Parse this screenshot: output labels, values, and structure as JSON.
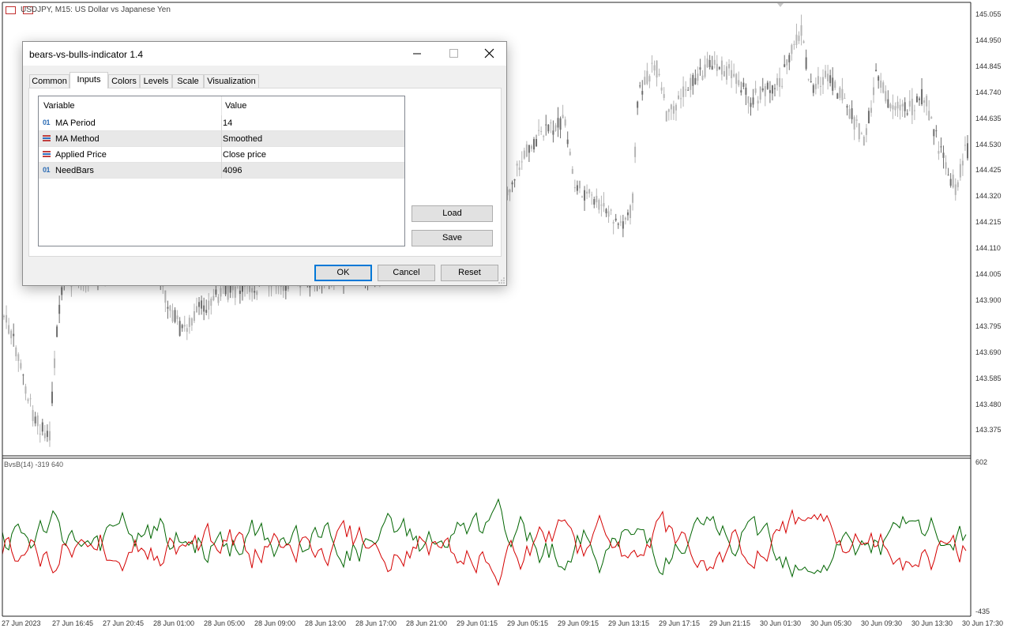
{
  "chart": {
    "title": "USDJPY, M15:  US Dollar vs Japanese Yen",
    "price_labels": [
      "145.055",
      "144.950",
      "144.845",
      "144.740",
      "144.635",
      "144.530",
      "144.425",
      "144.320",
      "144.215",
      "144.110",
      "144.005",
      "143.900",
      "143.795",
      "143.690",
      "143.585",
      "143.480",
      "143.375"
    ],
    "time_labels": [
      "27 Jun 2023",
      "27 Jun 16:45",
      "27 Jun 20:45",
      "28 Jun 01:00",
      "28 Jun 05:00",
      "28 Jun 09:00",
      "28 Jun 13:00",
      "28 Jun 17:00",
      "28 Jun 21:00",
      "29 Jun 01:15",
      "29 Jun 05:15",
      "29 Jun 09:15",
      "29 Jun 13:15",
      "29 Jun 17:15",
      "29 Jun 21:15",
      "30 Jun 01:30",
      "30 Jun 05:30",
      "30 Jun 09:30",
      "30 Jun 13:30",
      "30 Jun 17:30"
    ],
    "candle_color": "#b4b4b4",
    "candle_dark_color": "#6e6e6e"
  },
  "indicator": {
    "title": "BvsB(14) -319 640",
    "scale_max": "602",
    "scale_min": "-435",
    "bulls_color": "#006400",
    "bears_color": "#d40000"
  },
  "dialog": {
    "title": "bears-vs-bulls-indicator 1.4",
    "tabs": [
      "Common",
      "Inputs",
      "Colors",
      "Levels",
      "Scale",
      "Visualization"
    ],
    "active_tab": "Inputs",
    "columns": {
      "variable": "Variable",
      "value": "Value"
    },
    "rows": [
      {
        "icon": "01",
        "variable": "MA Period",
        "value": "14"
      },
      {
        "icon": "list",
        "variable": "MA Method",
        "value": "Smoothed"
      },
      {
        "icon": "list",
        "variable": "Applied Price",
        "value": "Close price"
      },
      {
        "icon": "01",
        "variable": "NeedBars",
        "value": "4096"
      }
    ],
    "buttons": {
      "load": "Load",
      "save": "Save",
      "ok": "OK",
      "cancel": "Cancel",
      "reset": "Reset"
    }
  }
}
